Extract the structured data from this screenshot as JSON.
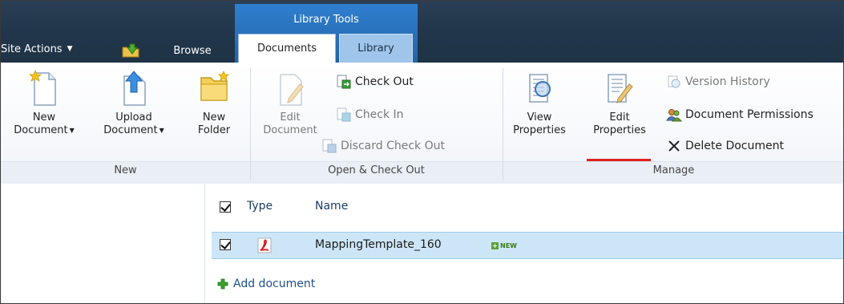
{
  "context_group": {
    "title": "Library Tools"
  },
  "nav": {
    "site_actions": "Site Actions",
    "tabs": [
      "Browse",
      "Documents",
      "Library"
    ]
  },
  "ribbon": {
    "groups": [
      {
        "label": "New"
      },
      {
        "label": "Open & Check Out"
      },
      {
        "label": "Manage"
      }
    ],
    "new_document": [
      "New",
      "Document"
    ],
    "upload_document": [
      "Upload",
      "Document"
    ],
    "new_folder": [
      "New",
      "Folder"
    ],
    "edit_document": [
      "Edit",
      "Document"
    ],
    "check_out": "Check Out",
    "check_in": "Check In",
    "discard_check_out": "Discard Check Out",
    "view_properties": [
      "View",
      "Properties"
    ],
    "edit_properties": [
      "Edit",
      "Properties"
    ],
    "version_history": "Version History",
    "document_permissions": "Document Permissions",
    "delete_document": "Delete Document"
  },
  "list": {
    "columns": [
      "Type",
      "Name"
    ],
    "rows": [
      {
        "name": "MappingTemplate_160",
        "badge": "NEW",
        "selected": true
      }
    ],
    "add_document": "Add document"
  },
  "colors": {
    "topbar": "#21374c",
    "context_group": "#2a6fb6",
    "selected_row": "#cde6f7",
    "accent_underline": "#e02020"
  }
}
